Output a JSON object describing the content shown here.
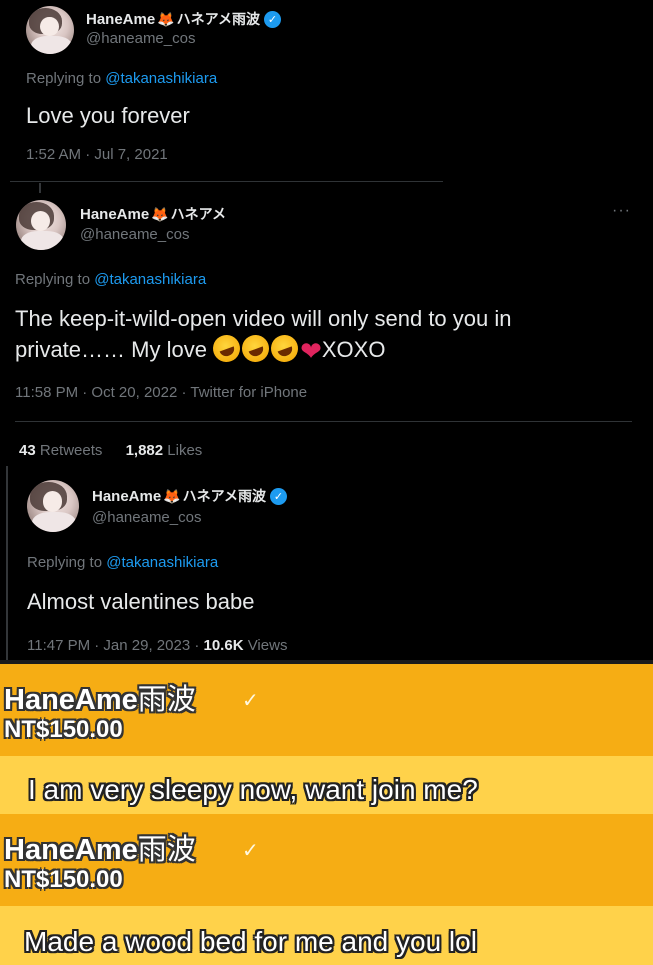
{
  "tweet1": {
    "display_name": "HaneAme",
    "name_jp": "ハネアメ雨波",
    "handle": "@haneame_cos",
    "replying_prefix": "Replying to",
    "mention": "@takanashikiara",
    "text": "Love you forever",
    "timestamp": "1:52 AM · Jul 7, 2021"
  },
  "tweet2": {
    "display_name": "HaneAme",
    "name_jp": "ハネアメ",
    "handle": "@haneame_cos",
    "more": "···",
    "replying_prefix": "Replying to",
    "mention": "@takanashikiara",
    "text_line1": "The keep-it-wild-open video will only send to you in",
    "text_line2_prefix": "private…… My love",
    "text_line2_suffix": "XOXO",
    "timestamp": "11:58 PM · Oct 20, 2022 · Twitter for iPhone",
    "retweets_count": "43",
    "retweets_label": "Retweets",
    "likes_count": "1,882",
    "likes_label": "Likes"
  },
  "tweet3": {
    "display_name": "HaneAme",
    "name_jp": "ハネアメ雨波",
    "handle": "@haneame_cos",
    "replying_prefix": "Replying to",
    "mention": "@takanashikiara",
    "text": "Almost valentines babe",
    "timestamp": "11:47 PM · Jan 29, 2023 ·",
    "views_count": "10.6K",
    "views_label": "Views"
  },
  "stream": {
    "donation1": {
      "name": "HaneAme",
      "name_cjk": "雨波",
      "amount": "NT$150.00",
      "message": "I am very sleepy now, want join me?"
    },
    "donation2": {
      "name": "HaneAme",
      "name_cjk": "雨波",
      "amount": "NT$150.00",
      "message": "Made a wood bed for me and you lol"
    }
  },
  "colors": {
    "background": "#000000",
    "text": "#e7e9ea",
    "muted": "#71767b",
    "link": "#1d9bf0",
    "stream_yellow": "#fbbd23"
  }
}
